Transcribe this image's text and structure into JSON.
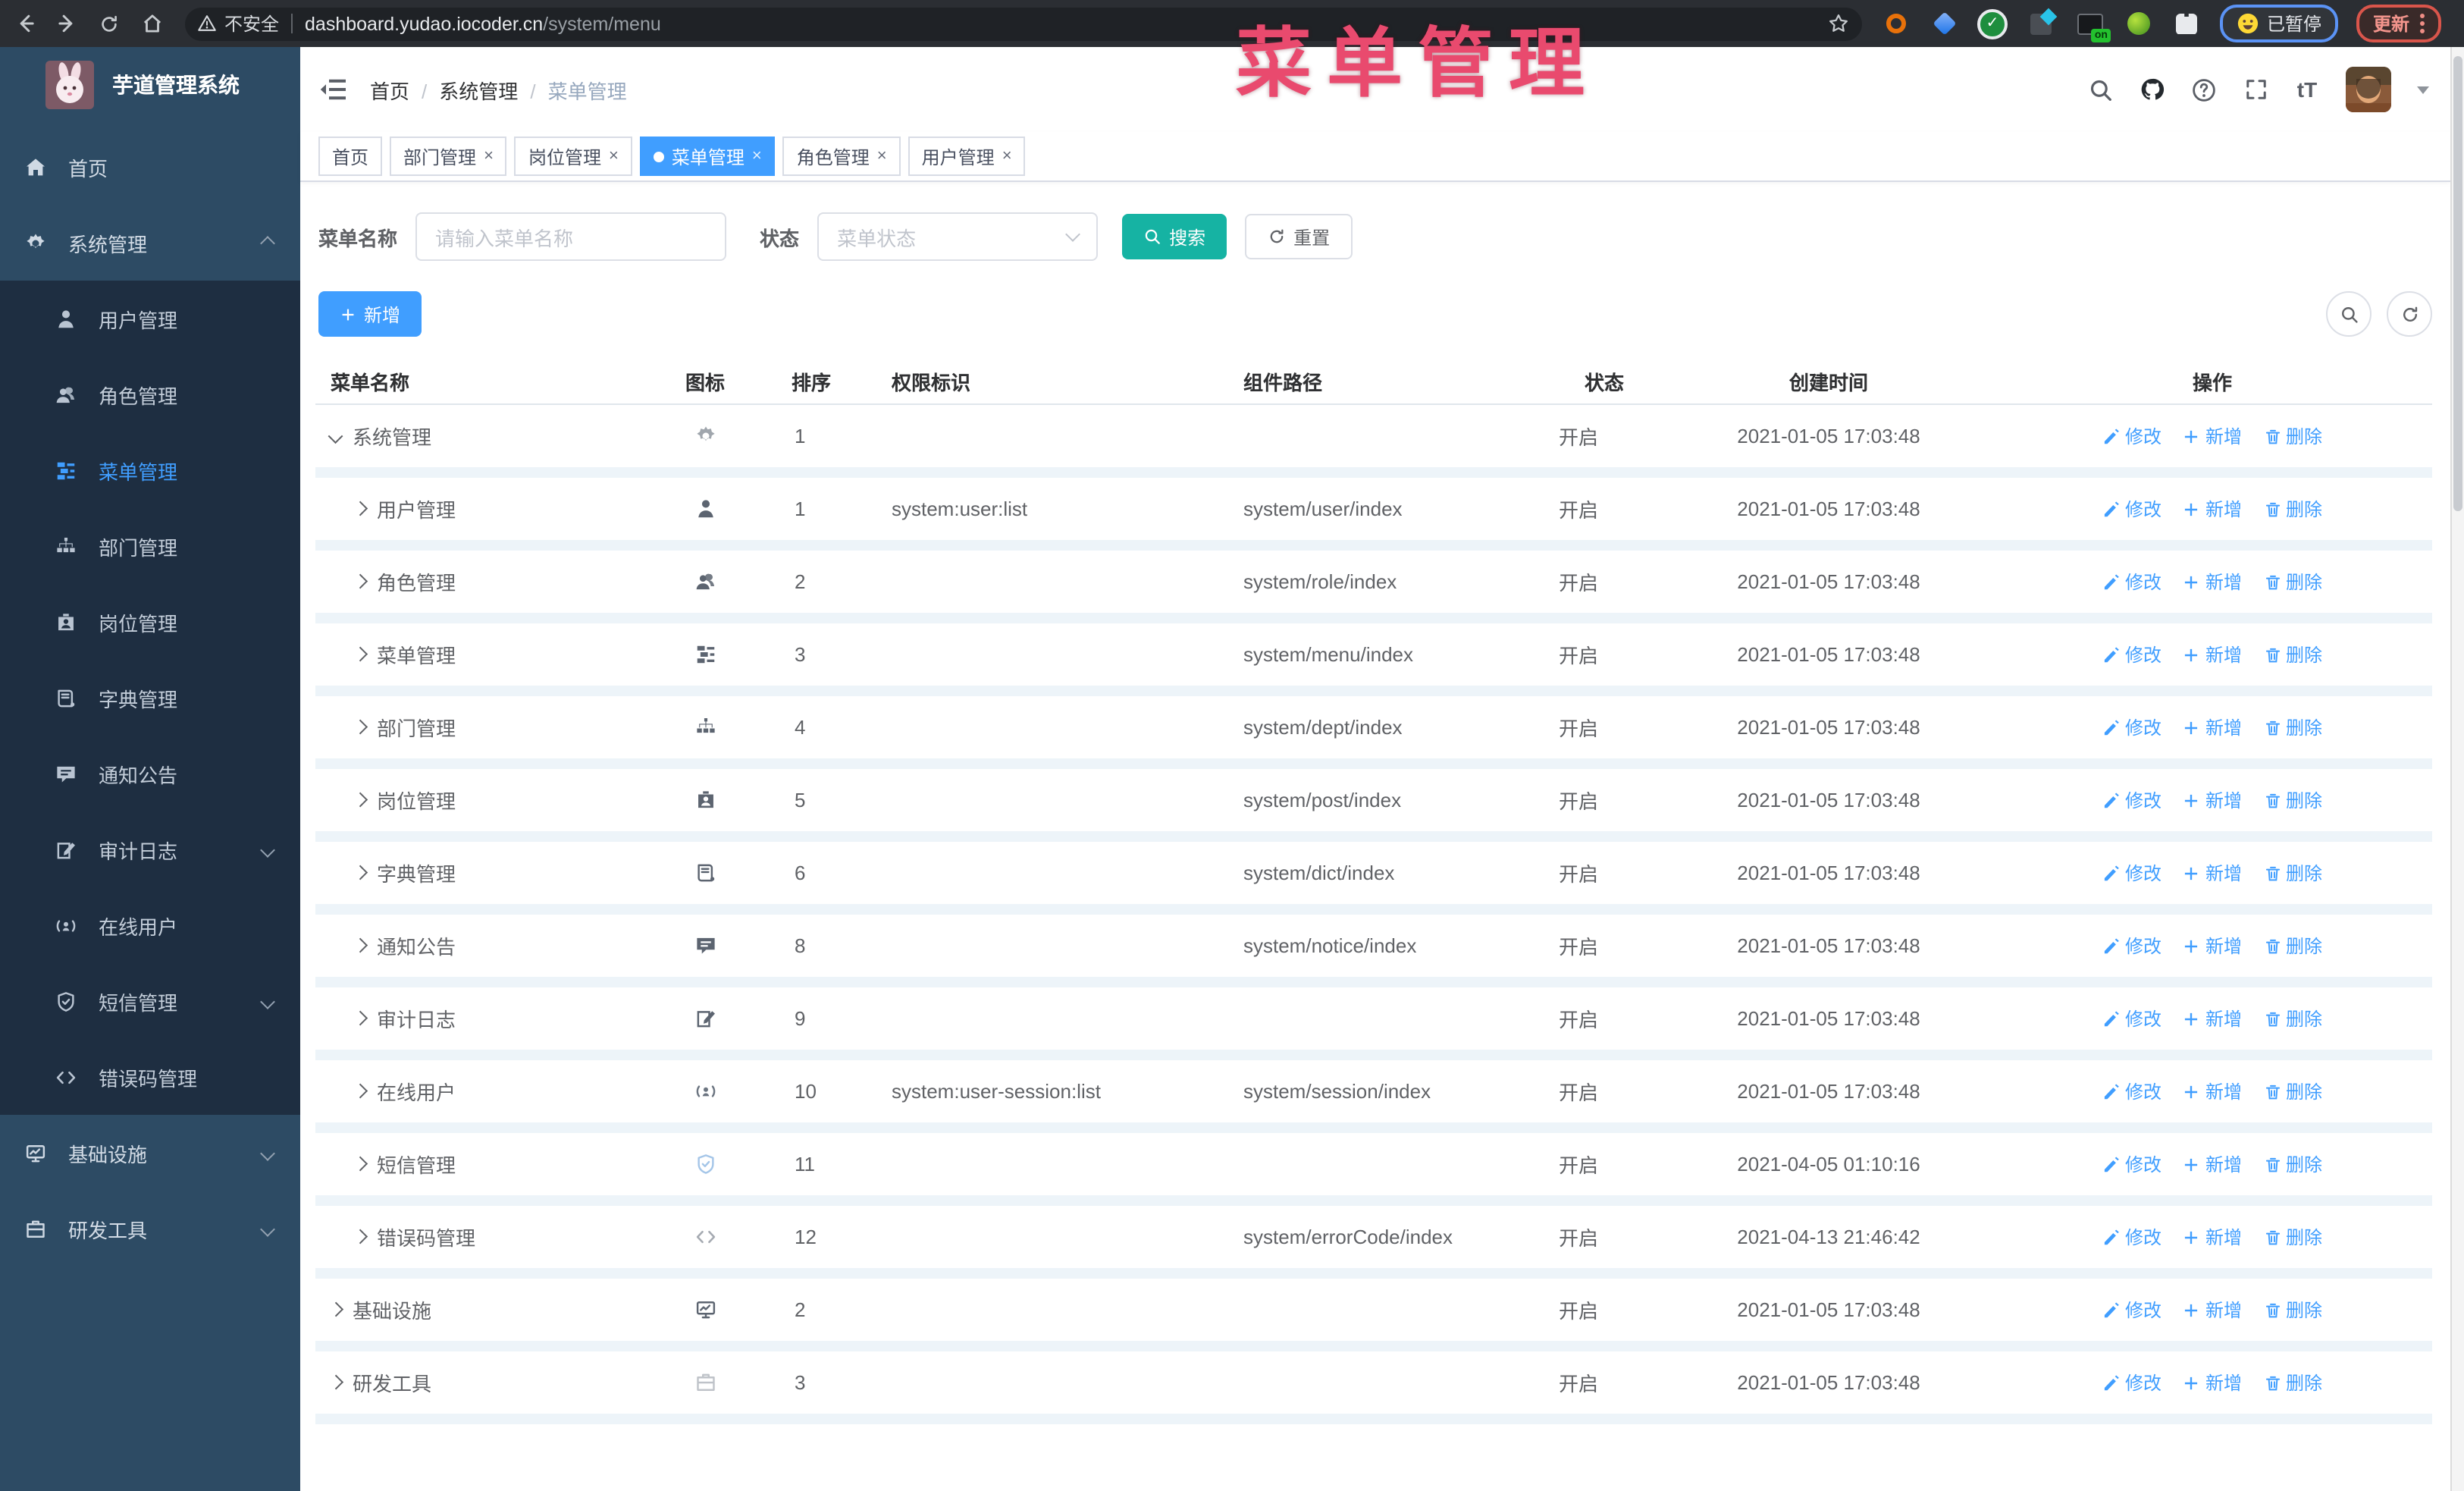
{
  "browser": {
    "security_label": "不安全",
    "url_host": "dashboard.yudao.iocoder.cn",
    "url_path": "/system/menu",
    "ext_on_label": "on",
    "paused_badge": "已暂停",
    "update_button": "更新"
  },
  "overlay_title": "菜单管理",
  "sidebar": {
    "app_title": "芋道管理系统",
    "items": [
      {
        "id": "home",
        "label": "首页",
        "icon": "home-icon",
        "level": 0
      },
      {
        "id": "system",
        "label": "系统管理",
        "icon": "gear-icon",
        "level": 0,
        "arrow": "up"
      },
      {
        "id": "user",
        "label": "用户管理",
        "icon": "user-icon",
        "level": 1
      },
      {
        "id": "role",
        "label": "角色管理",
        "icon": "users-icon",
        "level": 1
      },
      {
        "id": "menu",
        "label": "菜单管理",
        "icon": "menu-list-icon",
        "level": 1,
        "active": true
      },
      {
        "id": "dept",
        "label": "部门管理",
        "icon": "org-tree-icon",
        "level": 1
      },
      {
        "id": "post",
        "label": "岗位管理",
        "icon": "badge-icon",
        "level": 1
      },
      {
        "id": "dict",
        "label": "字典管理",
        "icon": "dict-icon",
        "level": 1
      },
      {
        "id": "notice",
        "label": "通知公告",
        "icon": "megaphone-icon",
        "level": 1
      },
      {
        "id": "audit-log",
        "label": "审计日志",
        "icon": "log-icon",
        "level": 1,
        "arrow": "down"
      },
      {
        "id": "online-user",
        "label": "在线用户",
        "icon": "online-icon",
        "level": 1
      },
      {
        "id": "sms",
        "label": "短信管理",
        "icon": "shield-icon",
        "level": 1,
        "arrow": "down"
      },
      {
        "id": "error-code",
        "label": "错误码管理",
        "icon": "code-icon",
        "level": 1
      },
      {
        "id": "infra",
        "label": "基础设施",
        "icon": "monitor-icon",
        "level": 0,
        "arrow": "down"
      },
      {
        "id": "dev-tools",
        "label": "研发工具",
        "icon": "briefcase-icon",
        "level": 0,
        "arrow": "down"
      }
    ]
  },
  "header": {
    "breadcrumb": [
      "首页",
      "系统管理",
      "菜单管理"
    ],
    "text_size_label": "tT"
  },
  "tabs": [
    {
      "label": "首页",
      "closable": false,
      "active": false
    },
    {
      "label": "部门管理",
      "closable": true,
      "active": false
    },
    {
      "label": "岗位管理",
      "closable": true,
      "active": false
    },
    {
      "label": "菜单管理",
      "closable": true,
      "active": true
    },
    {
      "label": "角色管理",
      "closable": true,
      "active": false
    },
    {
      "label": "用户管理",
      "closable": true,
      "active": false
    }
  ],
  "filters": {
    "name_label": "菜单名称",
    "name_placeholder": "请输入菜单名称",
    "status_label": "状态",
    "status_placeholder": "菜单状态",
    "search_button": "搜索",
    "reset_button": "重置",
    "add_button": "新增"
  },
  "table": {
    "columns": [
      "菜单名称",
      "图标",
      "排序",
      "权限标识",
      "组件路径",
      "状态",
      "创建时间",
      "操作"
    ],
    "action_labels": {
      "edit": "修改",
      "add": "新增",
      "delete": "删除"
    },
    "rows": [
      {
        "name": "系统管理",
        "icon": "gear-icon",
        "level": 0,
        "expanded": true,
        "sort": "1",
        "perm": "",
        "path": "",
        "status": "开启",
        "created": "2021-01-05 17:03:48"
      },
      {
        "name": "用户管理",
        "icon": "user-icon",
        "level": 1,
        "sort": "1",
        "perm": "system:user:list",
        "path": "system/user/index",
        "status": "开启",
        "created": "2021-01-05 17:03:48"
      },
      {
        "name": "角色管理",
        "icon": "users-icon",
        "level": 1,
        "sort": "2",
        "perm": "",
        "path": "system/role/index",
        "status": "开启",
        "created": "2021-01-05 17:03:48"
      },
      {
        "name": "菜单管理",
        "icon": "menu-list-icon",
        "level": 1,
        "sort": "3",
        "perm": "",
        "path": "system/menu/index",
        "status": "开启",
        "created": "2021-01-05 17:03:48"
      },
      {
        "name": "部门管理",
        "icon": "org-tree-icon",
        "level": 1,
        "sort": "4",
        "perm": "",
        "path": "system/dept/index",
        "status": "开启",
        "created": "2021-01-05 17:03:48"
      },
      {
        "name": "岗位管理",
        "icon": "badge-icon",
        "level": 1,
        "sort": "5",
        "perm": "",
        "path": "system/post/index",
        "status": "开启",
        "created": "2021-01-05 17:03:48"
      },
      {
        "name": "字典管理",
        "icon": "dict-icon",
        "level": 1,
        "sort": "6",
        "perm": "",
        "path": "system/dict/index",
        "status": "开启",
        "created": "2021-01-05 17:03:48"
      },
      {
        "name": "通知公告",
        "icon": "megaphone-icon",
        "level": 1,
        "sort": "8",
        "perm": "",
        "path": "system/notice/index",
        "status": "开启",
        "created": "2021-01-05 17:03:48"
      },
      {
        "name": "审计日志",
        "icon": "log-icon",
        "level": 1,
        "sort": "9",
        "perm": "",
        "path": "",
        "status": "开启",
        "created": "2021-01-05 17:03:48"
      },
      {
        "name": "在线用户",
        "icon": "online-icon",
        "level": 1,
        "sort": "10",
        "perm": "system:user-session:list",
        "path": "system/session/index",
        "status": "开启",
        "created": "2021-01-05 17:03:48"
      },
      {
        "name": "短信管理",
        "icon": "shield-icon",
        "level": 1,
        "sort": "11",
        "perm": "",
        "path": "",
        "status": "开启",
        "created": "2021-04-05 01:10:16"
      },
      {
        "name": "错误码管理",
        "icon": "code-icon",
        "level": 1,
        "sort": "12",
        "perm": "",
        "path": "system/errorCode/index",
        "status": "开启",
        "created": "2021-04-13 21:46:42"
      },
      {
        "name": "基础设施",
        "icon": "monitor-icon",
        "level": 0,
        "sort": "2",
        "perm": "",
        "path": "",
        "status": "开启",
        "created": "2021-01-05 17:03:48"
      },
      {
        "name": "研发工具",
        "icon": "briefcase-icon",
        "level": 0,
        "sort": "3",
        "perm": "",
        "path": "",
        "status": "开启",
        "created": "2021-01-05 17:03:48"
      }
    ]
  },
  "colors": {
    "primary": "#409eff",
    "teal": "#16b3a3",
    "overlay_pink": "#e94a6e",
    "sidebar_base": "#2d4b64",
    "sidebar_sub": "#1e2e41",
    "chrome_bar": "#2b2e33",
    "tab_border": "#d8dce5",
    "row_band": "#edf4f9",
    "text_main": "#606266"
  }
}
